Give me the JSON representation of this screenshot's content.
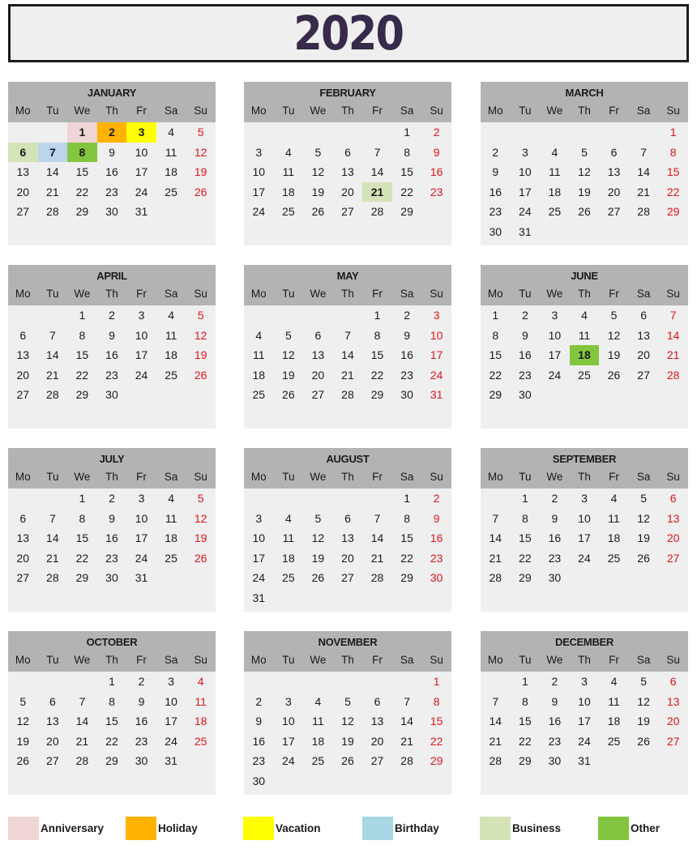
{
  "title": "2020",
  "day_names": [
    "Mo",
    "Tu",
    "We",
    "Th",
    "Fr",
    "Sa",
    "Su"
  ],
  "legend": [
    {
      "label": "Anniversary",
      "color": "#efd5d5"
    },
    {
      "label": "Holiday",
      "color": "#ffb300"
    },
    {
      "label": "Vacation",
      "color": "#ffff00"
    },
    {
      "label": "Birthday",
      "color": "#a9d6e3"
    },
    {
      "label": "Business",
      "color": "#d5e3b8"
    },
    {
      "label": "Other",
      "color": "#84c540"
    }
  ],
  "months": [
    {
      "name": "JANUARY",
      "weeks": [
        [
          "",
          "",
          "1",
          "2",
          "3",
          "4",
          "5"
        ],
        [
          "6",
          "7",
          "8",
          "9",
          "10",
          "11",
          "12"
        ],
        [
          "13",
          "14",
          "15",
          "16",
          "17",
          "18",
          "19"
        ],
        [
          "20",
          "21",
          "22",
          "23",
          "24",
          "25",
          "26"
        ],
        [
          "27",
          "28",
          "29",
          "30",
          "31",
          "",
          ""
        ]
      ],
      "highlights": {
        "1": "#efd5d5",
        "2": "#ffb300",
        "3": "#ffff00",
        "6": "#d5e3b8",
        "7": "#bcd4ee",
        "8": "#84c540"
      }
    },
    {
      "name": "FEBRUARY",
      "weeks": [
        [
          "",
          "",
          "",
          "",
          "",
          "1",
          "2"
        ],
        [
          "3",
          "4",
          "5",
          "6",
          "7",
          "8",
          "9"
        ],
        [
          "10",
          "11",
          "12",
          "13",
          "14",
          "15",
          "16"
        ],
        [
          "17",
          "18",
          "19",
          "20",
          "21",
          "22",
          "23"
        ],
        [
          "24",
          "25",
          "26",
          "27",
          "28",
          "29",
          ""
        ]
      ],
      "highlights": {
        "21": "#d5e3b8"
      }
    },
    {
      "name": "MARCH",
      "weeks": [
        [
          "",
          "",
          "",
          "",
          "",
          "",
          "1"
        ],
        [
          "2",
          "3",
          "4",
          "5",
          "6",
          "7",
          "8"
        ],
        [
          "9",
          "10",
          "11",
          "12",
          "13",
          "14",
          "15"
        ],
        [
          "16",
          "17",
          "18",
          "19",
          "20",
          "21",
          "22"
        ],
        [
          "23",
          "24",
          "25",
          "26",
          "27",
          "28",
          "29"
        ],
        [
          "30",
          "31",
          "",
          "",
          "",
          "",
          ""
        ]
      ],
      "highlights": {}
    },
    {
      "name": "APRIL",
      "weeks": [
        [
          "",
          "",
          "1",
          "2",
          "3",
          "4",
          "5"
        ],
        [
          "6",
          "7",
          "8",
          "9",
          "10",
          "11",
          "12"
        ],
        [
          "13",
          "14",
          "15",
          "16",
          "17",
          "18",
          "19"
        ],
        [
          "20",
          "21",
          "22",
          "23",
          "24",
          "25",
          "26"
        ],
        [
          "27",
          "28",
          "29",
          "30",
          "",
          "",
          ""
        ]
      ],
      "highlights": {}
    },
    {
      "name": "MAY",
      "weeks": [
        [
          "",
          "",
          "",
          "",
          "1",
          "2",
          "3"
        ],
        [
          "4",
          "5",
          "6",
          "7",
          "8",
          "9",
          "10"
        ],
        [
          "11",
          "12",
          "13",
          "14",
          "15",
          "16",
          "17"
        ],
        [
          "18",
          "19",
          "20",
          "21",
          "22",
          "23",
          "24"
        ],
        [
          "25",
          "26",
          "27",
          "28",
          "29",
          "30",
          "31"
        ]
      ],
      "highlights": {}
    },
    {
      "name": "JUNE",
      "weeks": [
        [
          "1",
          "2",
          "3",
          "4",
          "5",
          "6",
          "7"
        ],
        [
          "8",
          "9",
          "10",
          "11",
          "12",
          "13",
          "14"
        ],
        [
          "15",
          "16",
          "17",
          "18",
          "19",
          "20",
          "21"
        ],
        [
          "22",
          "23",
          "24",
          "25",
          "26",
          "27",
          "28"
        ],
        [
          "29",
          "30",
          "",
          "",
          "",
          "",
          ""
        ]
      ],
      "highlights": {
        "18": "#84c540"
      }
    },
    {
      "name": "JULY",
      "weeks": [
        [
          "",
          "",
          "1",
          "2",
          "3",
          "4",
          "5"
        ],
        [
          "6",
          "7",
          "8",
          "9",
          "10",
          "11",
          "12"
        ],
        [
          "13",
          "14",
          "15",
          "16",
          "17",
          "18",
          "19"
        ],
        [
          "20",
          "21",
          "22",
          "23",
          "24",
          "25",
          "26"
        ],
        [
          "27",
          "28",
          "29",
          "30",
          "31",
          "",
          ""
        ]
      ],
      "highlights": {}
    },
    {
      "name": "AUGUST",
      "weeks": [
        [
          "",
          "",
          "",
          "",
          "",
          "1",
          "2"
        ],
        [
          "3",
          "4",
          "5",
          "6",
          "7",
          "8",
          "9"
        ],
        [
          "10",
          "11",
          "12",
          "13",
          "14",
          "15",
          "16"
        ],
        [
          "17",
          "18",
          "19",
          "20",
          "21",
          "22",
          "23"
        ],
        [
          "24",
          "25",
          "26",
          "27",
          "28",
          "29",
          "30"
        ],
        [
          "31",
          "",
          "",
          "",
          "",
          "",
          ""
        ]
      ],
      "highlights": {}
    },
    {
      "name": "SEPTEMBER",
      "weeks": [
        [
          "",
          "1",
          "2",
          "3",
          "4",
          "5",
          "6"
        ],
        [
          "7",
          "8",
          "9",
          "10",
          "11",
          "12",
          "13"
        ],
        [
          "14",
          "15",
          "16",
          "17",
          "18",
          "19",
          "20"
        ],
        [
          "21",
          "22",
          "23",
          "24",
          "25",
          "26",
          "27"
        ],
        [
          "28",
          "29",
          "30",
          "",
          "",
          "",
          ""
        ]
      ],
      "highlights": {}
    },
    {
      "name": "OCTOBER",
      "weeks": [
        [
          "",
          "",
          "",
          "1",
          "2",
          "3",
          "4"
        ],
        [
          "5",
          "6",
          "7",
          "8",
          "9",
          "10",
          "11"
        ],
        [
          "12",
          "13",
          "14",
          "15",
          "16",
          "17",
          "18"
        ],
        [
          "19",
          "20",
          "21",
          "22",
          "23",
          "24",
          "25"
        ],
        [
          "26",
          "27",
          "28",
          "29",
          "30",
          "31",
          ""
        ]
      ],
      "highlights": {}
    },
    {
      "name": "NOVEMBER",
      "weeks": [
        [
          "",
          "",
          "",
          "",
          "",
          "",
          "1"
        ],
        [
          "2",
          "3",
          "4",
          "5",
          "6",
          "7",
          "8"
        ],
        [
          "9",
          "10",
          "11",
          "12",
          "13",
          "14",
          "15"
        ],
        [
          "16",
          "17",
          "18",
          "19",
          "20",
          "21",
          "22"
        ],
        [
          "23",
          "24",
          "25",
          "26",
          "27",
          "28",
          "29"
        ],
        [
          "30",
          "",
          "",
          "",
          "",
          "",
          ""
        ]
      ],
      "highlights": {}
    },
    {
      "name": "DECEMBER",
      "weeks": [
        [
          "",
          "1",
          "2",
          "3",
          "4",
          "5",
          "6"
        ],
        [
          "7",
          "8",
          "9",
          "10",
          "11",
          "12",
          "13"
        ],
        [
          "14",
          "15",
          "16",
          "17",
          "18",
          "19",
          "20"
        ],
        [
          "21",
          "22",
          "23",
          "24",
          "25",
          "26",
          "27"
        ],
        [
          "28",
          "29",
          "30",
          "31",
          "",
          "",
          ""
        ]
      ],
      "highlights": {}
    }
  ]
}
